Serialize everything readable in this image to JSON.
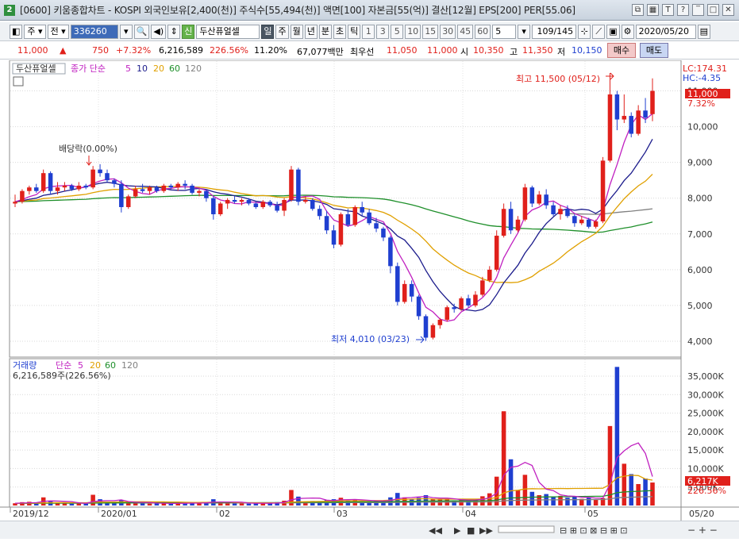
{
  "window": {
    "number": "2",
    "title": "[0600] 키움종합차트 - KOSPI 외국인보유[2,400(천)] 주식수[55,494(천)] 액면[100] 자본금[55(억)] 결산[12월] EPS[200] PER[55.06]"
  },
  "toolbar": {
    "period_type": "주",
    "prev_label": "전",
    "stock_code": "336260",
    "new_badge": "신",
    "stock_name": "두산퓨얼셀",
    "period_tabs": [
      "일",
      "주",
      "월",
      "년",
      "분",
      "초",
      "틱"
    ],
    "interval_buttons": [
      "1",
      "3",
      "5",
      "10",
      "15",
      "30",
      "45",
      "60"
    ],
    "interval_value": "5",
    "page_counter": "109/145",
    "date": "2020/05/20"
  },
  "quote": {
    "price": "11,000",
    "change_arrow": "▲",
    "change": "750",
    "change_rate": "+7.32%",
    "volume": "6,216,589",
    "volume_ratio": "226.56%",
    "turnover_rate": "11.20%",
    "amount": "67,077백만",
    "best_bid_label": "최우선",
    "best_ask": "11,050",
    "best_bid": "11,000",
    "open_label": "시",
    "open": "10,350",
    "high_label": "고",
    "high": "11,350",
    "low_label": "저",
    "low": "10,150",
    "buy_label": "매수",
    "sell_label": "매도"
  },
  "price_legend": {
    "stock": "두산퓨얼셀",
    "ma_label": "종가 단순",
    "ma_periods": [
      "5",
      "10",
      "20",
      "60",
      "120"
    ]
  },
  "volume_legend": {
    "label": "거래량",
    "ma_label": "단순",
    "ma_periods": [
      "5",
      "20",
      "60",
      "120"
    ],
    "current": "6,216,589주(226.56%)"
  },
  "annotations": {
    "lc": "LC:174.31",
    "hc": "HC:-4.35",
    "dividend": "배당락(0.00%)",
    "high_marker": "최고 11,500 (05/12)",
    "low_marker": "최저 4,010 (03/23)",
    "price_tag": "11,000",
    "price_tag_rate": "7.32%",
    "volume_tag": "6,217K",
    "volume_tag_rate": "226.56%"
  },
  "colors": {
    "up": "#e0201b",
    "down": "#1f3fd0",
    "ma5": "#c020c0",
    "ma10": "#1c1c8c",
    "ma20": "#e0a000",
    "ma60": "#1e8f2a",
    "ma120": "#808080"
  },
  "chart_data": {
    "type": "candlestick",
    "price_axis_ticks": [
      "11,000",
      "10,000",
      "9,000",
      "8,000",
      "7,000",
      "6,000",
      "5,000",
      "4,000"
    ],
    "volume_axis_ticks": [
      "35,000K",
      "30,000K",
      "25,000K",
      "20,000K",
      "15,000K",
      "10,000K",
      "5,000K"
    ],
    "x_labels": [
      "2019/12",
      "2020/01",
      "02",
      "03",
      "04",
      "05",
      "05/20"
    ],
    "ohlc": [
      [
        7850,
        8100,
        7750,
        7900
      ],
      [
        7900,
        8250,
        7850,
        8200
      ],
      [
        8200,
        8350,
        8100,
        8300
      ],
      [
        8300,
        8400,
        8150,
        8200
      ],
      [
        8200,
        8800,
        8150,
        8700
      ],
      [
        8700,
        8750,
        8100,
        8200
      ],
      [
        8200,
        8450,
        8100,
        8300
      ],
      [
        8300,
        8450,
        8200,
        8350
      ],
      [
        8350,
        8400,
        8200,
        8250
      ],
      [
        8250,
        8450,
        8200,
        8350
      ],
      [
        8350,
        8400,
        8250,
        8300
      ],
      [
        8300,
        8900,
        8250,
        8800
      ],
      [
        8800,
        8950,
        8600,
        8700
      ],
      [
        8700,
        8800,
        8450,
        8500
      ],
      [
        8500,
        8550,
        8300,
        8400
      ],
      [
        8400,
        8500,
        7600,
        7750
      ],
      [
        7750,
        8100,
        7700,
        8050
      ],
      [
        8050,
        8350,
        8000,
        8250
      ],
      [
        8250,
        8400,
        8150,
        8200
      ],
      [
        8200,
        8350,
        8100,
        8300
      ],
      [
        8300,
        8350,
        8150,
        8200
      ],
      [
        8200,
        8400,
        8150,
        8350
      ],
      [
        8350,
        8400,
        8250,
        8300
      ],
      [
        8300,
        8450,
        8200,
        8400
      ],
      [
        8400,
        8500,
        8250,
        8350
      ],
      [
        8350,
        8400,
        8100,
        8150
      ],
      [
        8150,
        8250,
        8050,
        8200
      ],
      [
        8200,
        8250,
        7900,
        8000
      ],
      [
        8000,
        8050,
        7400,
        7550
      ],
      [
        7550,
        7900,
        7500,
        7850
      ],
      [
        7850,
        8000,
        7700,
        7950
      ],
      [
        7950,
        8050,
        7850,
        7900
      ],
      [
        7900,
        8000,
        7800,
        7950
      ],
      [
        7950,
        8000,
        7800,
        7850
      ],
      [
        7850,
        7900,
        7700,
        7750
      ],
      [
        7750,
        7950,
        7700,
        7900
      ],
      [
        7900,
        7950,
        7750,
        7800
      ],
      [
        7800,
        7900,
        7600,
        7650
      ],
      [
        7650,
        8000,
        7500,
        7950
      ],
      [
        7950,
        8900,
        7900,
        8800
      ],
      [
        8800,
        8850,
        7800,
        7900
      ],
      [
        7900,
        8050,
        7850,
        7950
      ],
      [
        7950,
        8000,
        7650,
        7700
      ],
      [
        7700,
        7800,
        7400,
        7500
      ],
      [
        7500,
        7650,
        7000,
        7100
      ],
      [
        7100,
        7250,
        6600,
        6700
      ],
      [
        6700,
        7600,
        6650,
        7550
      ],
      [
        7550,
        7700,
        7200,
        7250
      ],
      [
        7250,
        7800,
        7200,
        7750
      ],
      [
        7750,
        7900,
        7500,
        7600
      ],
      [
        7600,
        7700,
        7250,
        7300
      ],
      [
        7300,
        7450,
        7050,
        7150
      ],
      [
        7150,
        7200,
        6800,
        6900
      ],
      [
        6900,
        6950,
        5900,
        6100
      ],
      [
        6100,
        6200,
        5000,
        5100
      ],
      [
        5100,
        5700,
        5050,
        5600
      ],
      [
        5600,
        5700,
        5100,
        5250
      ],
      [
        5250,
        5300,
        4600,
        4700
      ],
      [
        4700,
        4750,
        4010,
        4100
      ],
      [
        4100,
        4500,
        4050,
        4450
      ],
      [
        4450,
        4650,
        4350,
        4600
      ],
      [
        4600,
        5000,
        4550,
        4950
      ],
      [
        4950,
        5050,
        4800,
        4900
      ],
      [
        4900,
        5250,
        4850,
        5200
      ],
      [
        5200,
        5300,
        4950,
        5000
      ],
      [
        5000,
        5400,
        4950,
        5300
      ],
      [
        5300,
        5800,
        5250,
        5700
      ],
      [
        5700,
        6100,
        5650,
        6000
      ],
      [
        6000,
        7100,
        5950,
        6950
      ],
      [
        6950,
        7850,
        6900,
        7700
      ],
      [
        7700,
        7900,
        7000,
        7100
      ],
      [
        7100,
        7500,
        7050,
        7400
      ],
      [
        7400,
        8400,
        7350,
        8300
      ],
      [
        8300,
        8350,
        7750,
        7850
      ],
      [
        7850,
        8200,
        7800,
        8100
      ],
      [
        8100,
        8250,
        7700,
        7800
      ],
      [
        7800,
        7900,
        7500,
        7550
      ],
      [
        7550,
        7800,
        7400,
        7700
      ],
      [
        7700,
        7800,
        7450,
        7500
      ],
      [
        7500,
        7550,
        7200,
        7300
      ],
      [
        7300,
        7500,
        7250,
        7400
      ],
      [
        7400,
        7450,
        7150,
        7200
      ],
      [
        7200,
        7400,
        7150,
        7350
      ],
      [
        7350,
        9150,
        7300,
        9050
      ],
      [
        9050,
        11500,
        9000,
        10900
      ],
      [
        10900,
        11000,
        9900,
        10200
      ],
      [
        10200,
        10900,
        10100,
        10300
      ],
      [
        10300,
        10400,
        9700,
        9800
      ],
      [
        9800,
        10600,
        9750,
        10450
      ],
      [
        10450,
        10800,
        10100,
        10250
      ],
      [
        10350,
        11350,
        10150,
        11000
      ]
    ],
    "volume": [
      600,
      900,
      1000,
      800,
      2200,
      1300,
      700,
      600,
      500,
      600,
      500,
      2900,
      1700,
      900,
      600,
      1500,
      700,
      800,
      600,
      500,
      600,
      600,
      500,
      700,
      600,
      800,
      600,
      800,
      1700,
      900,
      700,
      600,
      600,
      500,
      600,
      700,
      600,
      900,
      1300,
      4200,
      2400,
      1000,
      1200,
      1100,
      1500,
      1700,
      2100,
      1400,
      1500,
      900,
      1100,
      1300,
      1200,
      2200,
      3400,
      2200,
      1700,
      2100,
      2800,
      1800,
      1600,
      1700,
      1200,
      1500,
      1400,
      1700,
      2500,
      3300,
      7800,
      25500,
      12500,
      4200,
      8300,
      3700,
      2800,
      3100,
      2300,
      2600,
      2100,
      2400,
      1800,
      2100,
      1700,
      2000,
      21500,
      37500,
      11300,
      8500,
      5800,
      7300,
      6217
    ]
  }
}
